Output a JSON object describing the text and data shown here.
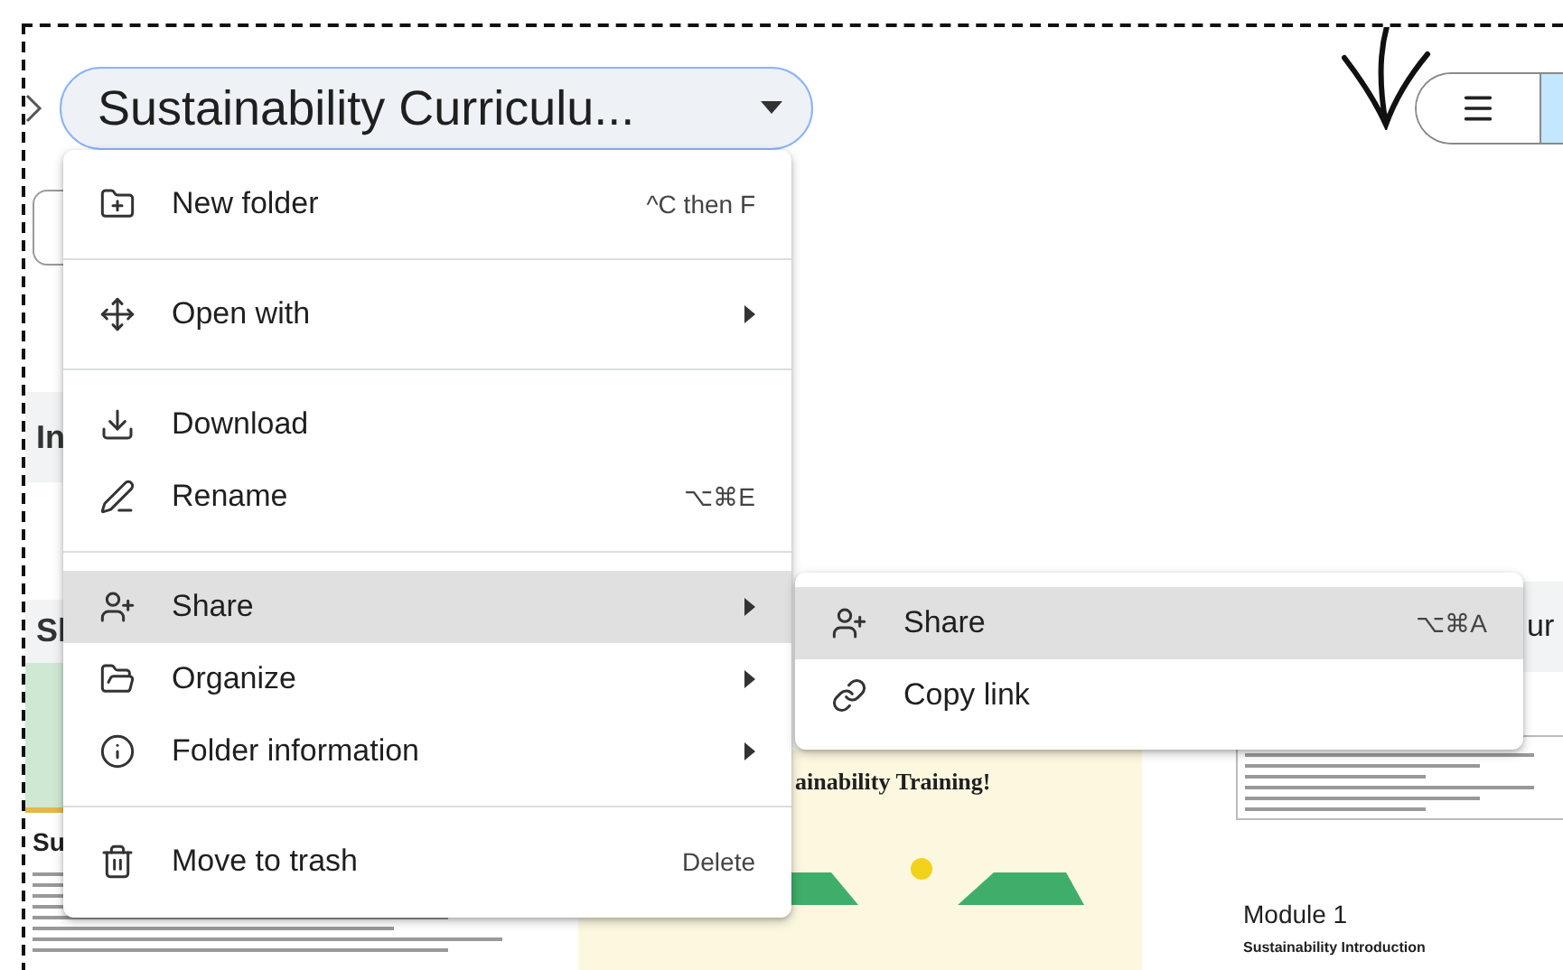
{
  "breadcrumb": {
    "title": "Sustainability Curriculu..."
  },
  "view_toggle": {
    "options": [
      {
        "selected": false
      },
      {
        "selected": true
      }
    ]
  },
  "menu": {
    "groups": [
      [
        {
          "label": "New folder",
          "shortcut": "^C then F",
          "submenu": false,
          "selected": false
        }
      ],
      [
        {
          "label": "Open with",
          "submenu": true,
          "selected": false
        }
      ],
      [
        {
          "label": "Download",
          "submenu": false,
          "selected": false
        },
        {
          "label": "Rename",
          "shortcut": "⌥⌘E",
          "submenu": false,
          "selected": false
        }
      ],
      [
        {
          "label": "Share",
          "submenu": true,
          "selected": true
        },
        {
          "label": "Organize",
          "submenu": true,
          "selected": false
        },
        {
          "label": "Folder information",
          "submenu": true,
          "selected": false
        }
      ],
      [
        {
          "label": "Move to trash",
          "shortcut": "Delete",
          "submenu": false,
          "selected": false
        }
      ]
    ]
  },
  "submenu": {
    "items": [
      {
        "label": "Share",
        "shortcut": "⌥⌘A",
        "selected": true
      },
      {
        "label": "Copy link",
        "selected": false
      }
    ]
  },
  "background": {
    "left_card": {
      "texts": [
        "In",
        "Sl",
        "Su"
      ]
    },
    "middle_card": {
      "title": "ainability Training!"
    },
    "right_card": {
      "header": "ur",
      "heading": "Module 1",
      "subheading": "Sustainability Introduction"
    }
  }
}
